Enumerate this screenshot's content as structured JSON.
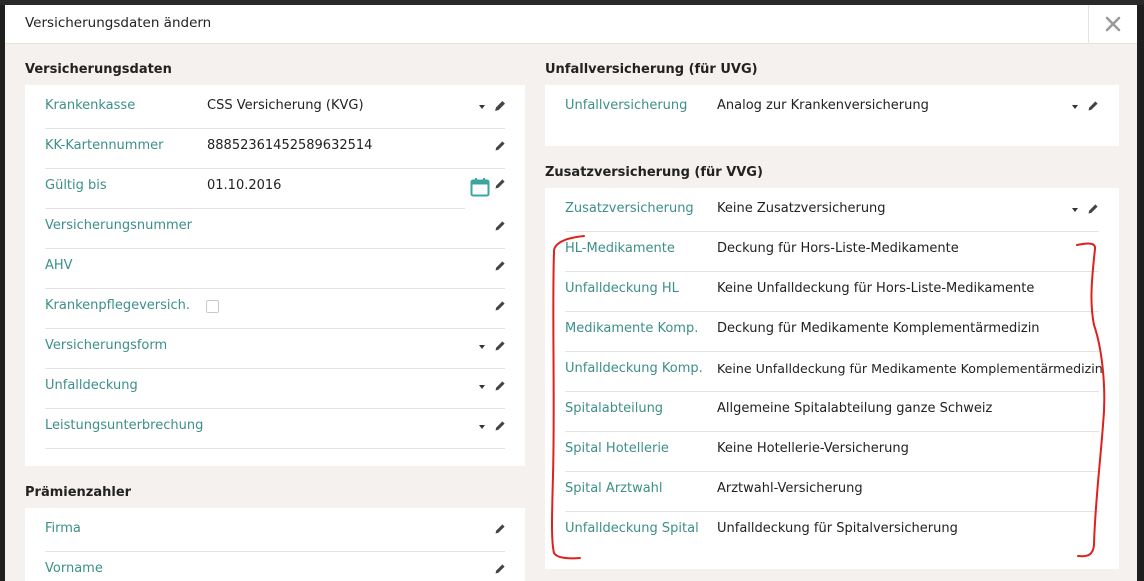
{
  "modal": {
    "title": "Versicherungsdaten ändern"
  },
  "versicherungsdaten": {
    "title": "Versicherungsdaten",
    "rows": [
      {
        "label": "Krankenkasse",
        "value": "CSS Versicherung (KVG)"
      },
      {
        "label": "KK-Kartennummer",
        "value": "88852361452589632514"
      },
      {
        "label": "Gültig bis",
        "value": "01.10.2016"
      },
      {
        "label": "Versicherungsnummer",
        "value": ""
      },
      {
        "label": "AHV",
        "value": ""
      },
      {
        "label": "Krankenpflegeversich.",
        "value": ""
      },
      {
        "label": "Versicherungsform",
        "value": ""
      },
      {
        "label": "Unfalldeckung",
        "value": ""
      },
      {
        "label": "Leistungsunterbrechung",
        "value": ""
      }
    ]
  },
  "praemienzahler": {
    "title": "Prämienzahler",
    "rows": [
      {
        "label": "Firma",
        "value": ""
      },
      {
        "label": "Vorname",
        "value": ""
      }
    ]
  },
  "uvg": {
    "title": "Unfallversicherung (für UVG)",
    "rows": [
      {
        "label": "Unfallversicherung",
        "value": "Analog zur Krankenversicherung"
      }
    ]
  },
  "vvg": {
    "title": "Zusatzversicherung (für VVG)",
    "rows": [
      {
        "label": "Zusatzversicherung",
        "value": "Keine Zusatzversicherung"
      },
      {
        "label": "HL-Medikamente",
        "value": "Deckung für Hors-Liste-Medikamente"
      },
      {
        "label": "Unfalldeckung HL",
        "value": "Keine Unfalldeckung für Hors-Liste-Medikamente"
      },
      {
        "label": "Medikamente Komp.",
        "value": "Deckung für Medikamente Komplementärmedizin"
      },
      {
        "label": "Unfalldeckung Komp.",
        "value": "Keine Unfalldeckung für Medikamente Komplementärmedizin"
      },
      {
        "label": "Spitalabteilung",
        "value": "Allgemeine Spitalabteilung ganze Schweiz"
      },
      {
        "label": "Spital Hotellerie",
        "value": "Keine Hotellerie-Versicherung"
      },
      {
        "label": "Spital Arztwahl",
        "value": "Arztwahl-Versicherung"
      },
      {
        "label": "Unfalldeckung Spital",
        "value": "Unfalldeckung für Spitalversicherung"
      }
    ]
  },
  "colors": {
    "label_teal": "#3c8f8a",
    "annotation_red": "#e0201c",
    "panel_bg": "#ffffff",
    "modal_bg": "#f4f1ee"
  },
  "icons": [
    "close-icon",
    "caret-down-icon",
    "pencil-icon",
    "calendar-icon",
    "checkbox"
  ]
}
